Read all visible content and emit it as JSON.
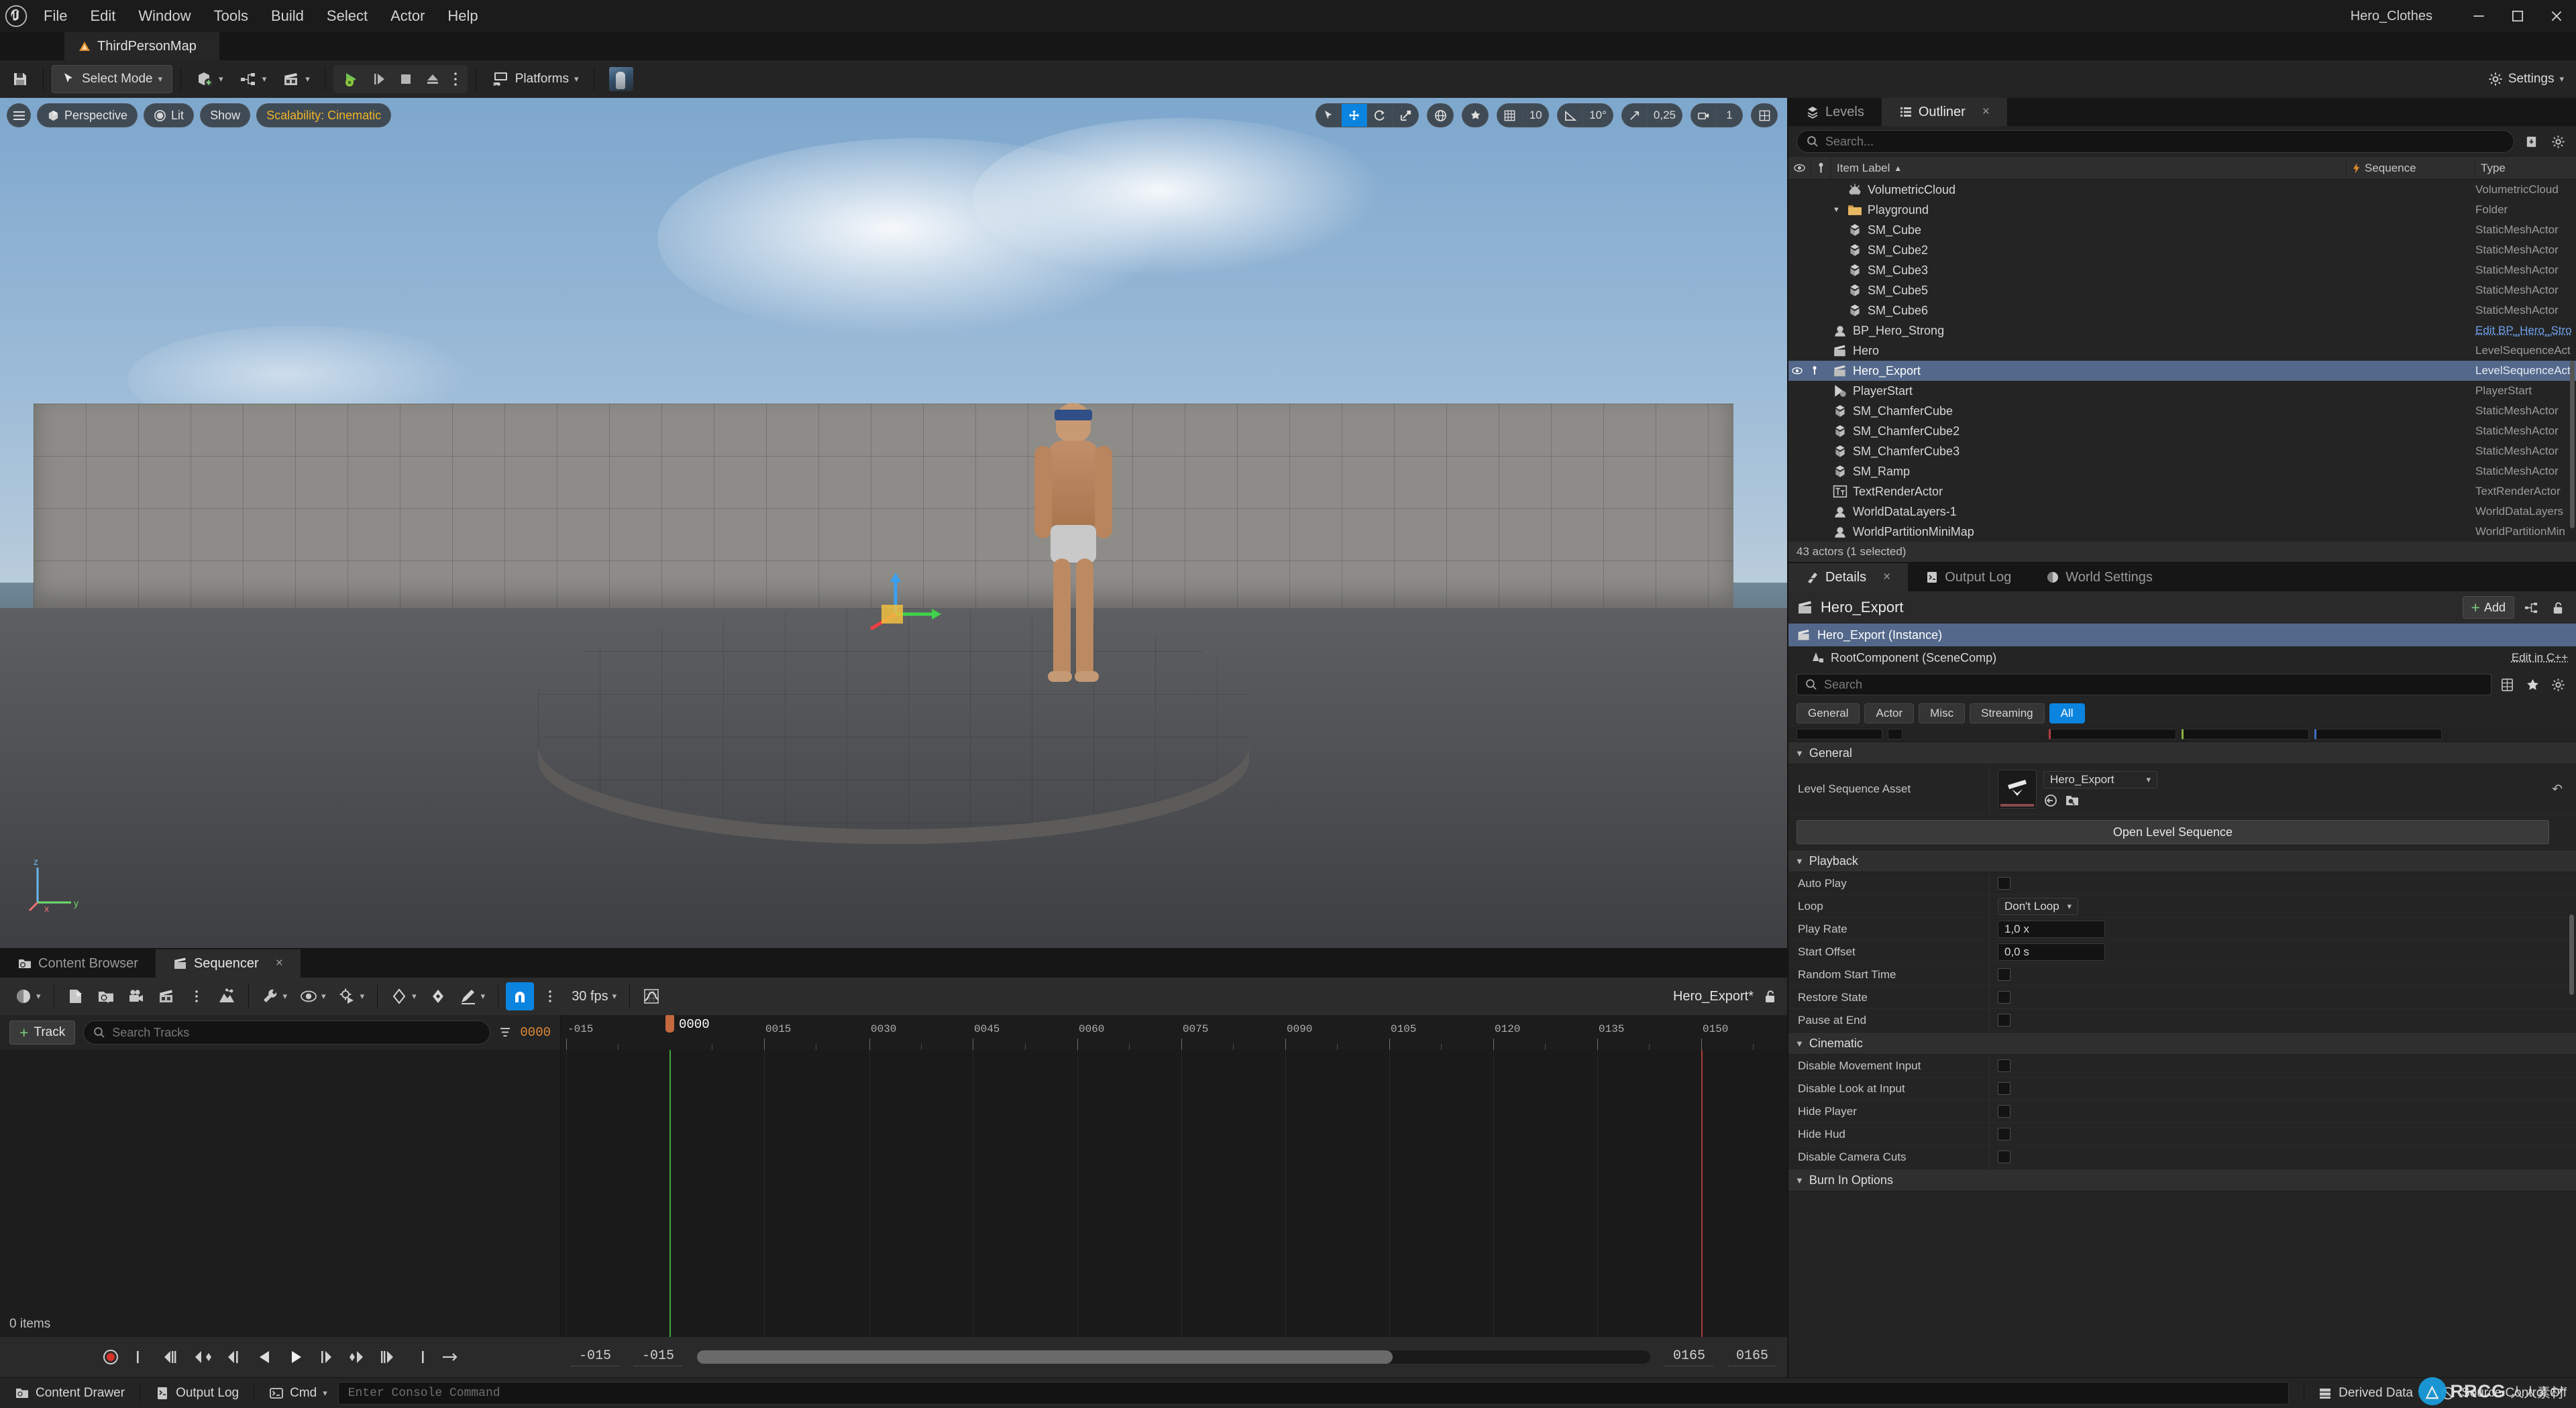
{
  "app": {
    "project_name": "Hero_Clothes",
    "level_tab": "ThirdPersonMap",
    "menus": [
      "File",
      "Edit",
      "Window",
      "Tools",
      "Build",
      "Select",
      "Actor",
      "Help"
    ],
    "window_controls": [
      "minimize-icon",
      "maximize-icon",
      "close-icon"
    ]
  },
  "toolbar": {
    "save_icon": "save-icon",
    "mode_label": "Select Mode",
    "add_icon": "add-actor-icon",
    "blueprint_icon": "blueprints-icon",
    "cinematics_icon": "cinematics-icon",
    "play_icon": "play-icon",
    "skip_icon": "skip-icon",
    "stop_icon": "stop-icon",
    "eject_icon": "eject-icon",
    "more_icon": "more-options-icon",
    "platforms_label": "Platforms",
    "settings_label": "Settings"
  },
  "viewport": {
    "menu_icon": "viewport-menu-icon",
    "perspective_label": "Perspective",
    "lighting_label": "Lit",
    "show_label": "Show",
    "scalability_label": "Scalability: Cinematic",
    "gizmo": {
      "select_icon": "select-arrow-icon",
      "move_icon": "move-gizmo-icon",
      "rotate_icon": "rotate-gizmo-icon",
      "scale_icon": "scale-gizmo-icon",
      "active": "move"
    },
    "world_icon": "world-coords-icon",
    "surface_snap_icon": "surface-snap-icon",
    "grid_icon": "grid-snap-icon",
    "grid_value": "10",
    "angle_icon": "angle-snap-icon",
    "angle_value": "10°",
    "scale_icon2": "scale-snap-icon",
    "scale_value": "0,25",
    "camera_icon": "camera-speed-icon",
    "camera_value": "1",
    "layout_icon": "viewport-layout-icon"
  },
  "outliner": {
    "tabs": [
      {
        "label": "Levels",
        "icon": "levels-icon",
        "active": false,
        "closable": false
      },
      {
        "label": "Outliner",
        "icon": "outliner-icon",
        "active": true,
        "closable": true
      }
    ],
    "search_placeholder": "Search...",
    "save_icon": "save-outliner-icon",
    "settings_icon": "outliner-settings-icon",
    "columns": [
      {
        "label": "",
        "icon": "eye-icon"
      },
      {
        "label": "",
        "icon": "pin-icon"
      },
      {
        "label": "Item Label",
        "sort": "▲"
      },
      {
        "label": "Sequence",
        "icon": "bolt-icon"
      },
      {
        "label": "Type"
      }
    ],
    "rows": [
      {
        "label": "VolumetricCloud",
        "type": "VolumetricCloud",
        "icon": "cloud-icon",
        "indent": 1,
        "sequence": "",
        "selected": false
      },
      {
        "label": "Playground",
        "type": "Folder",
        "icon": "folder-icon",
        "indent": 0,
        "sequence": "",
        "selected": false,
        "expander": "▼"
      },
      {
        "label": "SM_Cube",
        "type": "StaticMeshActor",
        "icon": "mesh-icon",
        "indent": 1,
        "sequence": "",
        "selected": false
      },
      {
        "label": "SM_Cube2",
        "type": "StaticMeshActor",
        "icon": "mesh-icon",
        "indent": 1,
        "sequence": "",
        "selected": false
      },
      {
        "label": "SM_Cube3",
        "type": "StaticMeshActor",
        "icon": "mesh-icon",
        "indent": 1,
        "sequence": "",
        "selected": false
      },
      {
        "label": "SM_Cube5",
        "type": "StaticMeshActor",
        "icon": "mesh-icon",
        "indent": 1,
        "sequence": "",
        "selected": false
      },
      {
        "label": "SM_Cube6",
        "type": "StaticMeshActor",
        "icon": "mesh-icon",
        "indent": 1,
        "sequence": "",
        "selected": false
      },
      {
        "label": "BP_Hero_Strong",
        "type": "Edit BP_Hero_Stro",
        "icon": "actor-icon",
        "indent": 0,
        "sequence": "",
        "selected": false,
        "type_is_link": true
      },
      {
        "label": "Hero",
        "type": "LevelSequenceAct",
        "icon": "sequence-icon",
        "indent": 0,
        "sequence": "",
        "selected": false
      },
      {
        "label": "Hero_Export",
        "type": "LevelSequenceAct",
        "icon": "sequence-icon",
        "indent": 0,
        "sequence": "",
        "selected": true
      },
      {
        "label": "PlayerStart",
        "type": "PlayerStart",
        "icon": "playerstart-icon",
        "indent": 0,
        "sequence": "",
        "selected": false
      },
      {
        "label": "SM_ChamferCube",
        "type": "StaticMeshActor",
        "icon": "mesh-icon",
        "indent": 0,
        "sequence": "",
        "selected": false
      },
      {
        "label": "SM_ChamferCube2",
        "type": "StaticMeshActor",
        "icon": "mesh-icon",
        "indent": 0,
        "sequence": "",
        "selected": false
      },
      {
        "label": "SM_ChamferCube3",
        "type": "StaticMeshActor",
        "icon": "mesh-icon",
        "indent": 0,
        "sequence": "",
        "selected": false
      },
      {
        "label": "SM_Ramp",
        "type": "StaticMeshActor",
        "icon": "mesh-icon",
        "indent": 0,
        "sequence": "",
        "selected": false
      },
      {
        "label": "TextRenderActor",
        "type": "TextRenderActor",
        "icon": "text-icon",
        "indent": 0,
        "sequence": "",
        "selected": false
      },
      {
        "label": "WorldDataLayers-1",
        "type": "WorldDataLayers",
        "icon": "actor-icon",
        "indent": 0,
        "sequence": "",
        "selected": false
      },
      {
        "label": "WorldPartitionMiniMap",
        "type": "WorldPartitionMin",
        "icon": "actor-icon",
        "indent": 0,
        "sequence": "",
        "selected": false
      }
    ],
    "footer": "43 actors (1 selected)"
  },
  "details": {
    "tabs": [
      {
        "label": "Details",
        "icon": "details-icon",
        "active": true,
        "closable": true
      },
      {
        "label": "Output Log",
        "icon": "outputlog-icon",
        "active": false,
        "closable": false
      },
      {
        "label": "World Settings",
        "icon": "worldsettings-icon",
        "active": false,
        "closable": false
      }
    ],
    "object_title": "Hero_Export",
    "add_label": "Add",
    "component_icon": "add-component-icon",
    "lock_icon": "unlock-icon",
    "tree": [
      {
        "label": "Hero_Export (Instance)",
        "icon": "sequence-icon",
        "selected": true,
        "action": ""
      },
      {
        "label": "RootComponent (SceneComp)",
        "icon": "scenecomp-icon",
        "selected": false,
        "action": "Edit in C++"
      }
    ],
    "search_placeholder": "Search",
    "column_icon": "columns-icon",
    "favorite_icon": "star-icon",
    "settings_icon": "gear-icon",
    "filters": [
      {
        "label": "General",
        "active": false
      },
      {
        "label": "Actor",
        "active": false
      },
      {
        "label": "Misc",
        "active": false
      },
      {
        "label": "Streaming",
        "active": false
      },
      {
        "label": "All",
        "active": true
      }
    ],
    "sections": [
      {
        "name": "General",
        "expanded": true,
        "rows": [
          {
            "name": "Level Sequence Asset",
            "kind": "asset",
            "value": "Hero_Export",
            "thumb": "sequence-thumb-icon",
            "browse_icon": "browse-icon",
            "use_icon": "use-selected-icon",
            "reset_icon": "reset-icon"
          }
        ],
        "button": "Open Level Sequence"
      },
      {
        "name": "Playback",
        "expanded": true,
        "rows": [
          {
            "name": "Auto Play",
            "kind": "checkbox",
            "value": false
          },
          {
            "name": "Loop",
            "kind": "dropdown",
            "value": "Don't Loop"
          },
          {
            "name": "Play Rate",
            "kind": "text",
            "value": "1,0 x"
          },
          {
            "name": "Start Offset",
            "kind": "text",
            "value": "0,0 s"
          },
          {
            "name": "Random Start Time",
            "kind": "checkbox",
            "value": false
          },
          {
            "name": "Restore State",
            "kind": "checkbox",
            "value": false
          },
          {
            "name": "Pause at End",
            "kind": "checkbox",
            "value": false
          }
        ]
      },
      {
        "name": "Cinematic",
        "expanded": true,
        "rows": [
          {
            "name": "Disable Movement Input",
            "kind": "checkbox",
            "value": false
          },
          {
            "name": "Disable Look at Input",
            "kind": "checkbox",
            "value": false
          },
          {
            "name": "Hide Player",
            "kind": "checkbox",
            "value": false
          },
          {
            "name": "Hide Hud",
            "kind": "checkbox",
            "value": false
          },
          {
            "name": "Disable Camera Cuts",
            "kind": "checkbox",
            "value": false
          }
        ]
      },
      {
        "name": "Burn In Options",
        "expanded": true,
        "rows": []
      }
    ]
  },
  "sequencer": {
    "tabs": [
      {
        "label": "Content Browser",
        "icon": "content-browser-icon",
        "active": false,
        "closable": false
      },
      {
        "label": "Sequencer",
        "icon": "sequencer-icon",
        "active": true,
        "closable": true
      }
    ],
    "toolbar": {
      "world_icon": "world-icon",
      "create_camera_icon": "create-camera-icon",
      "find_icon": "find-in-content-icon",
      "camera_icon": "camera-icon",
      "sequence_icon": "sequence-icon",
      "more_icon": "more-icon",
      "actions_icon": "actions-icon",
      "wrench_icon": "wrench-icon",
      "eye_icon": "eye-icon",
      "playback_icon": "playback-options-icon",
      "keyframe_icon": "keyframe-icon",
      "keyframe2_icon": "keyframe-filled-icon",
      "autokey_icon": "auto-key-icon",
      "snap_icon": "magnet-snap-icon",
      "snap_active": true,
      "fps_label": "30 fps",
      "curves_icon": "curve-editor-icon",
      "title": "Hero_Export*",
      "lock_icon": "unlock-icon"
    },
    "add_track_label": "Track",
    "search_placeholder": "Search Tracks",
    "filter_icon": "filter-icon",
    "current_frame": "0000",
    "playhead_label": "0000",
    "ruler_ticks": [
      "-015",
      "0015",
      "0030",
      "0045",
      "0060",
      "0075",
      "0090",
      "0105",
      "0120",
      "0135",
      "0150"
    ],
    "items_count": "0 items",
    "transport": {
      "record_icon": "record-icon",
      "jump_start_icon": "jump-to-start-icon",
      "prev_key_icon": "previous-key-icon",
      "step_back_icon": "step-back-icon",
      "prev_frame_icon": "previous-frame-icon",
      "play_reverse_icon": "play-reverse-icon",
      "play_icon": "play-forward-icon",
      "next_frame_icon": "next-frame-icon",
      "next_key_icon": "next-key-icon",
      "step_fwd_icon": "step-forward-icon",
      "jump_end_icon": "jump-to-end-icon",
      "loop_icon": "loop-mode-icon"
    },
    "range_start_left": "-015",
    "range_start_right": "-015",
    "range_end_left": "0165",
    "range_end_right": "0165"
  },
  "statusbar": {
    "content_drawer": "Content Drawer",
    "output_log": "Output Log",
    "cmd_label": "Cmd",
    "console_placeholder": "Enter Console Command",
    "derived_data": "Derived Data",
    "source_control": "Source Control Off",
    "content_drawer_icon": "content-drawer-icon",
    "output_log_icon": "output-log-icon",
    "cmd_icon": "cmd-icon",
    "derived_data_icon": "derived-data-icon",
    "source_control_icon": "source-control-off-icon"
  },
  "watermark": {
    "brand": "RRCG",
    "cn_text": "人人素材"
  }
}
